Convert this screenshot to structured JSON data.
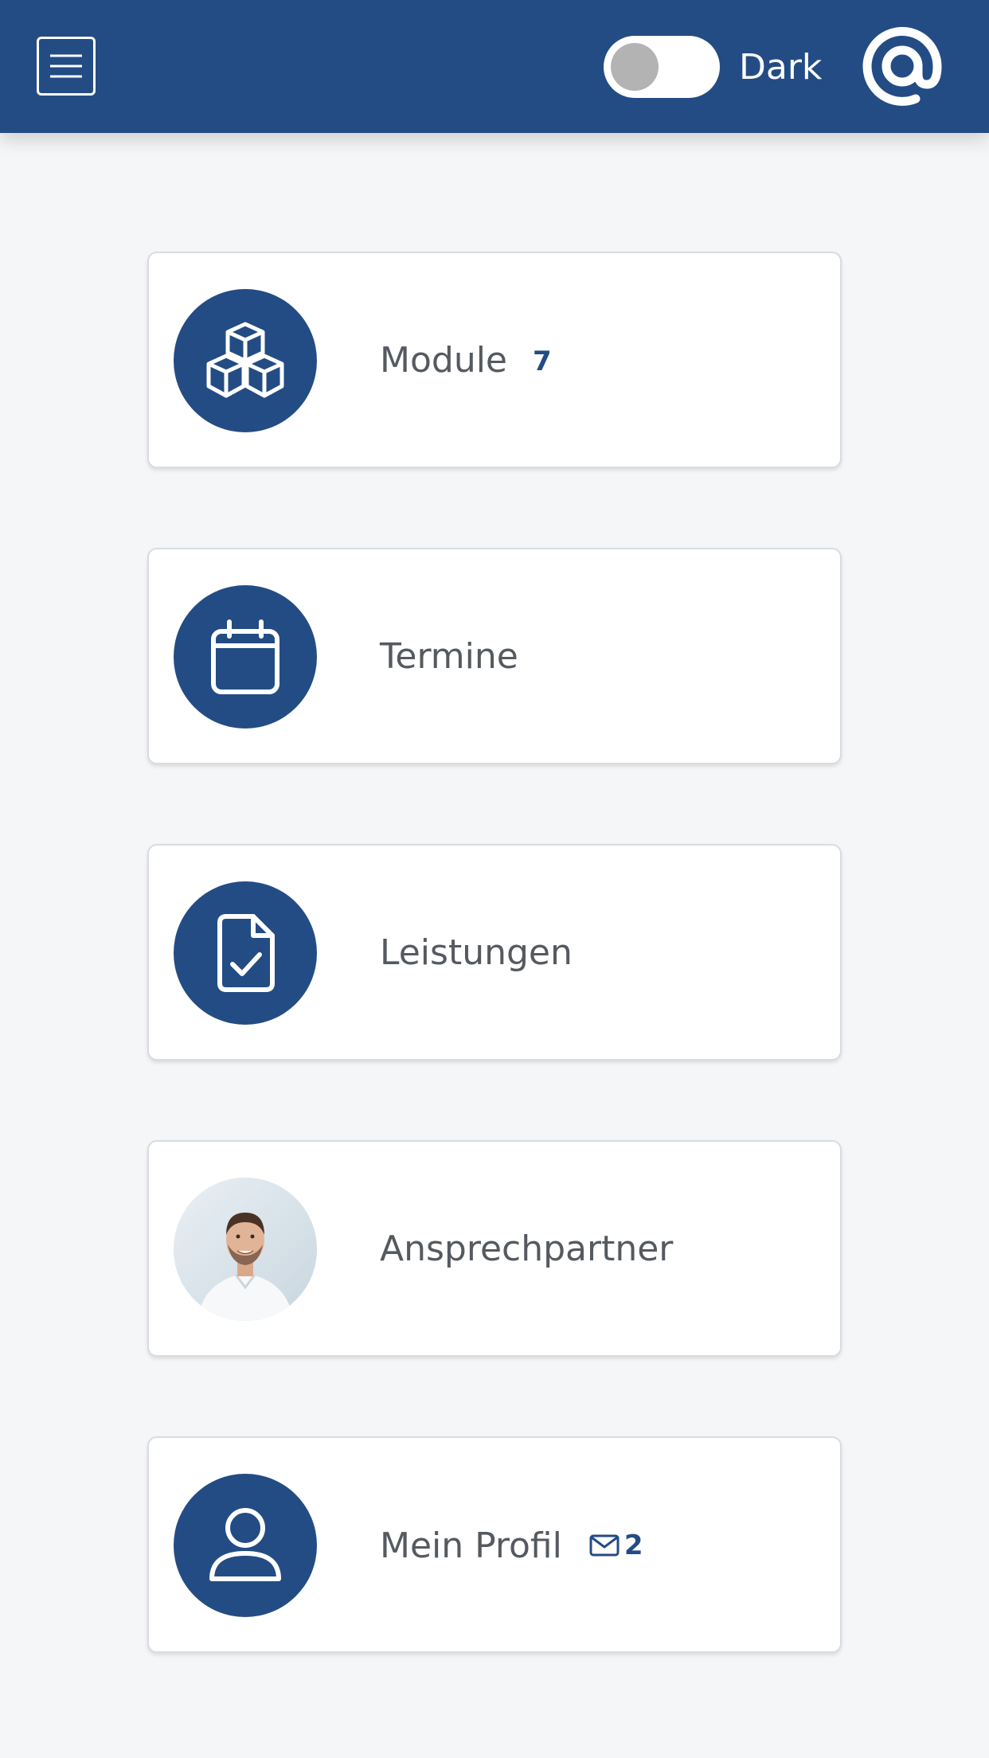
{
  "header": {
    "toggle_label": "Dark",
    "toggle_on": false,
    "menu_icon": "hamburger-menu-icon",
    "logo_icon": "at-sign-icon"
  },
  "colors": {
    "primary": "#234c84",
    "background": "#f5f6f8",
    "card": "#ffffff",
    "text": "#555a60",
    "toggle_knob": "#b3b3b3"
  },
  "tiles": [
    {
      "label": "Module",
      "badge": "7",
      "icon": "cubes-icon"
    },
    {
      "label": "Termine",
      "icon": "calendar-icon"
    },
    {
      "label": "Leistungen",
      "icon": "document-check-icon"
    },
    {
      "label": "Ansprechpartner",
      "icon": "contact-photo"
    },
    {
      "label": "Mein Profil",
      "mail_count": "2",
      "icon": "user-icon",
      "mail_icon": "envelope-icon"
    }
  ]
}
